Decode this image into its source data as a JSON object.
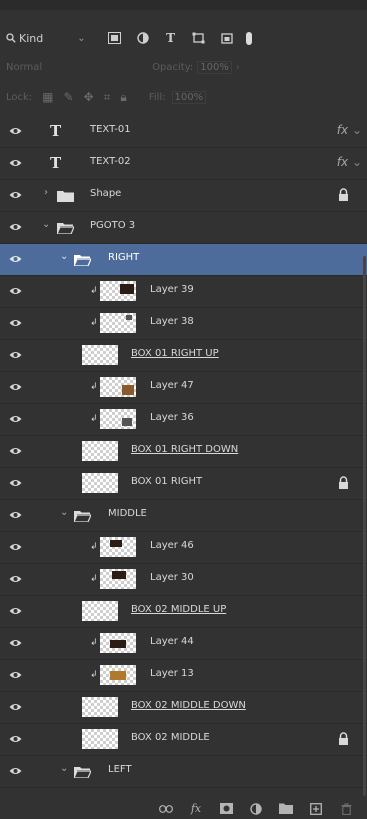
{
  "filter": {
    "search_icon": "search-icon",
    "kind_label": "Kind",
    "chevron": "⌄"
  },
  "blend": {
    "mode": "Normal",
    "opacity_label": "Opacity:",
    "opacity_value": "100%"
  },
  "lock": {
    "label": "Lock:",
    "fill_label": "Fill:",
    "fill_value": "100%"
  },
  "layers": [
    {
      "name": "TEXT-01",
      "kind": "text",
      "fx": "fx",
      "chev": "⌄"
    },
    {
      "name": "TEXT-02",
      "kind": "text",
      "fx": "fx",
      "chev": "⌄"
    },
    {
      "name": "Shape",
      "kind": "group",
      "expanded": false,
      "locked": true
    },
    {
      "name": "PGOTO 3",
      "kind": "group",
      "expanded": true
    },
    {
      "name": "RIGHT",
      "kind": "group",
      "expanded": true,
      "selected": true
    },
    {
      "name": "Layer 39",
      "kind": "layer",
      "clipped": true
    },
    {
      "name": "Layer 38",
      "kind": "layer",
      "clipped": true
    },
    {
      "name": "BOX 01 RIGHT UP",
      "kind": "layer",
      "linked": true
    },
    {
      "name": "Layer 47",
      "kind": "layer",
      "clipped": true
    },
    {
      "name": "Layer 36",
      "kind": "layer",
      "clipped": true
    },
    {
      "name": "BOX 01 RIGHT DOWN",
      "kind": "layer",
      "linked": true
    },
    {
      "name": "BOX 01 RIGHT",
      "kind": "layer",
      "locked": true
    },
    {
      "name": "MIDDLE",
      "kind": "group",
      "expanded": true
    },
    {
      "name": "Layer 46",
      "kind": "layer",
      "clipped": true
    },
    {
      "name": "Layer 30",
      "kind": "layer",
      "clipped": true
    },
    {
      "name": "BOX 02 MIDDLE UP",
      "kind": "layer",
      "linked": true
    },
    {
      "name": "Layer 44",
      "kind": "layer",
      "clipped": true
    },
    {
      "name": "Layer 13",
      "kind": "layer",
      "clipped": true
    },
    {
      "name": "BOX 02 MIDDLE DOWN",
      "kind": "layer",
      "linked": true
    },
    {
      "name": "BOX 02 MIDDLE",
      "kind": "layer",
      "locked": true
    },
    {
      "name": "LEFT",
      "kind": "group",
      "expanded": true
    }
  ],
  "bottom_bar": {
    "link": "link-layers-icon",
    "fx": "fx",
    "mask": "add-mask-icon",
    "adjust": "adjustment-layer-icon",
    "group": "new-group-icon",
    "new": "new-layer-icon",
    "trash": "delete-icon"
  },
  "colors": {
    "panel": "#323232",
    "selected": "#4d6c9b"
  }
}
